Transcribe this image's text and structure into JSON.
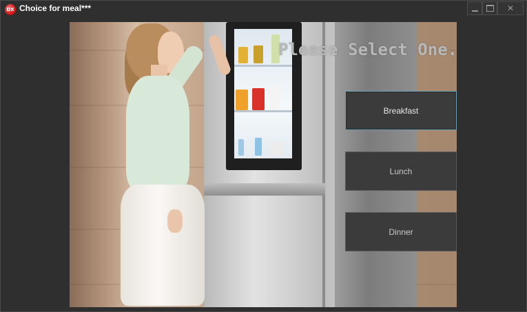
{
  "window": {
    "title": "Choice for meal***",
    "app_icon_text": "DX",
    "controls": {
      "minimize": "minimize-icon",
      "maximize": "maximize-icon",
      "close_symbol": "✕"
    }
  },
  "main": {
    "prompt": "Please Select One...",
    "buttons": [
      {
        "label": "Breakfast"
      },
      {
        "label": "Lunch"
      },
      {
        "label": "Dinner"
      }
    ]
  },
  "colors": {
    "window_bg": "#2f2f2f",
    "button_bg": "#3b3b3b",
    "focus_border": "#6fa3b7",
    "prompt_text": "#b8b8b8"
  }
}
